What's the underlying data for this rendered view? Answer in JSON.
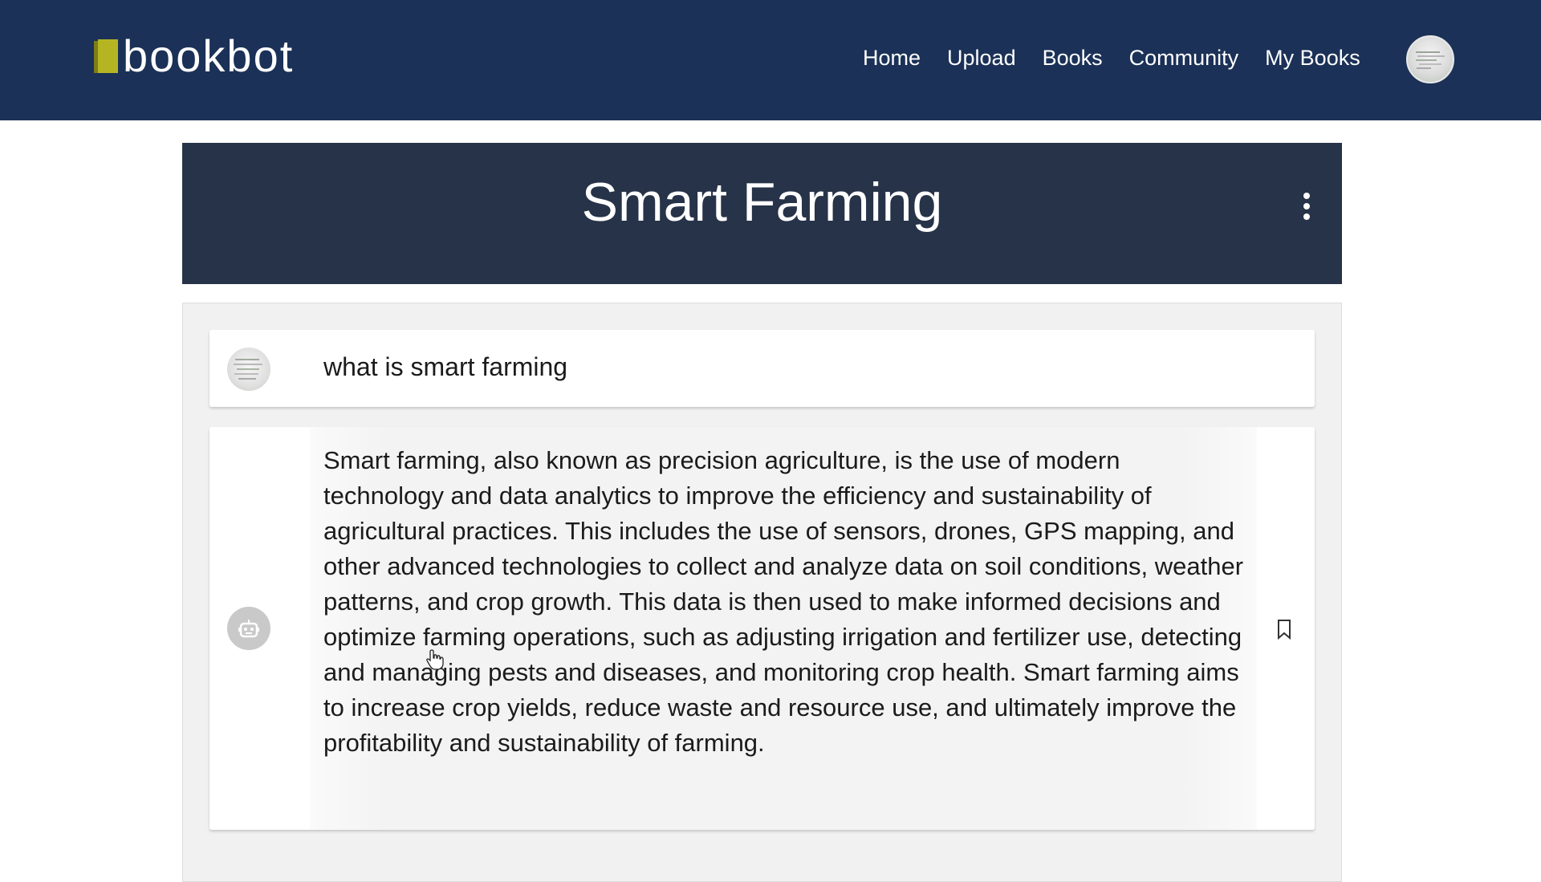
{
  "header": {
    "logo_text": "bookbot",
    "logo_colors": {
      "cover": "#b5b524",
      "spine": "#7e7e18"
    },
    "background": "#1b3157",
    "nav": [
      {
        "label": "Home"
      },
      {
        "label": "Upload"
      },
      {
        "label": "Books"
      },
      {
        "label": "Community"
      },
      {
        "label": "My Books"
      }
    ],
    "avatar_icon": "user-avatar-icon"
  },
  "book": {
    "title": "Smart Farming",
    "menu_icon": "more-vertical-icon",
    "banner_color": "#263348"
  },
  "chat": {
    "user_message": {
      "avatar_icon": "user-avatar-icon",
      "text": "what is smart farming"
    },
    "bot_message": {
      "avatar_icon": "robot-icon",
      "text": "Smart farming, also known as precision agriculture, is the use of modern technology and data analytics to improve the efficiency and sustainability of agricultural practices. This includes the use of sensors, drones, GPS mapping, and other advanced technologies to collect and analyze data on soil conditions, weather patterns, and crop growth. This data is then used to make informed decisions and optimize farming operations, such as adjusting irrigation and fertilizer use, detecting and managing pests and diseases, and monitoring crop health. Smart farming aims to increase crop yields, reduce waste and resource use, and ultimately improve the profitability and sustainability of farming.",
      "action_icon": "bookmark-icon"
    }
  }
}
